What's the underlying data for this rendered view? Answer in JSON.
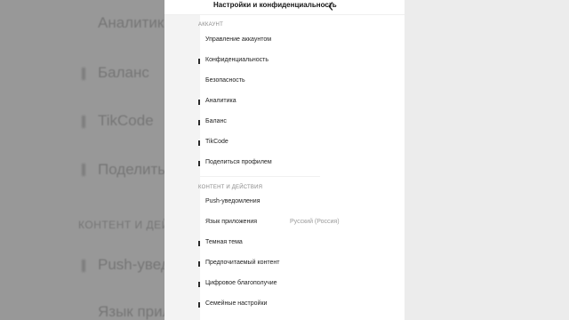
{
  "background": {
    "items": [
      "Аналитика",
      "Баланс",
      "TikCode",
      "Поделиться",
      "КОНТЕНТ И ДЕЙС",
      "Push-уведо",
      "Язык прил"
    ]
  },
  "header": {
    "title": "Настройки и конфиденциальность"
  },
  "sections": [
    {
      "title": "АККАУНТ"
    },
    {
      "title": "КОНТЕНТ И ДЕЙСТВИЯ"
    }
  ],
  "account_items": [
    {
      "label": "Управление аккаунтом"
    },
    {
      "label": "Конфиденциальность"
    },
    {
      "label": "Безопасность"
    },
    {
      "label": "Аналитика"
    },
    {
      "label": "Баланс"
    },
    {
      "label": "TikCode"
    },
    {
      "label": "Поделиться профилем"
    }
  ],
  "content_items": [
    {
      "label": "Push-уведомления",
      "value": ""
    },
    {
      "label": "Язык приложения",
      "value": "Русский (Россия)"
    },
    {
      "label": "Темная тема",
      "value": ""
    },
    {
      "label": "Предпочитаемый контент",
      "value": ""
    },
    {
      "label": "Цифровое благополучие",
      "value": ""
    },
    {
      "label": "Семейные настройки",
      "value": ""
    }
  ]
}
